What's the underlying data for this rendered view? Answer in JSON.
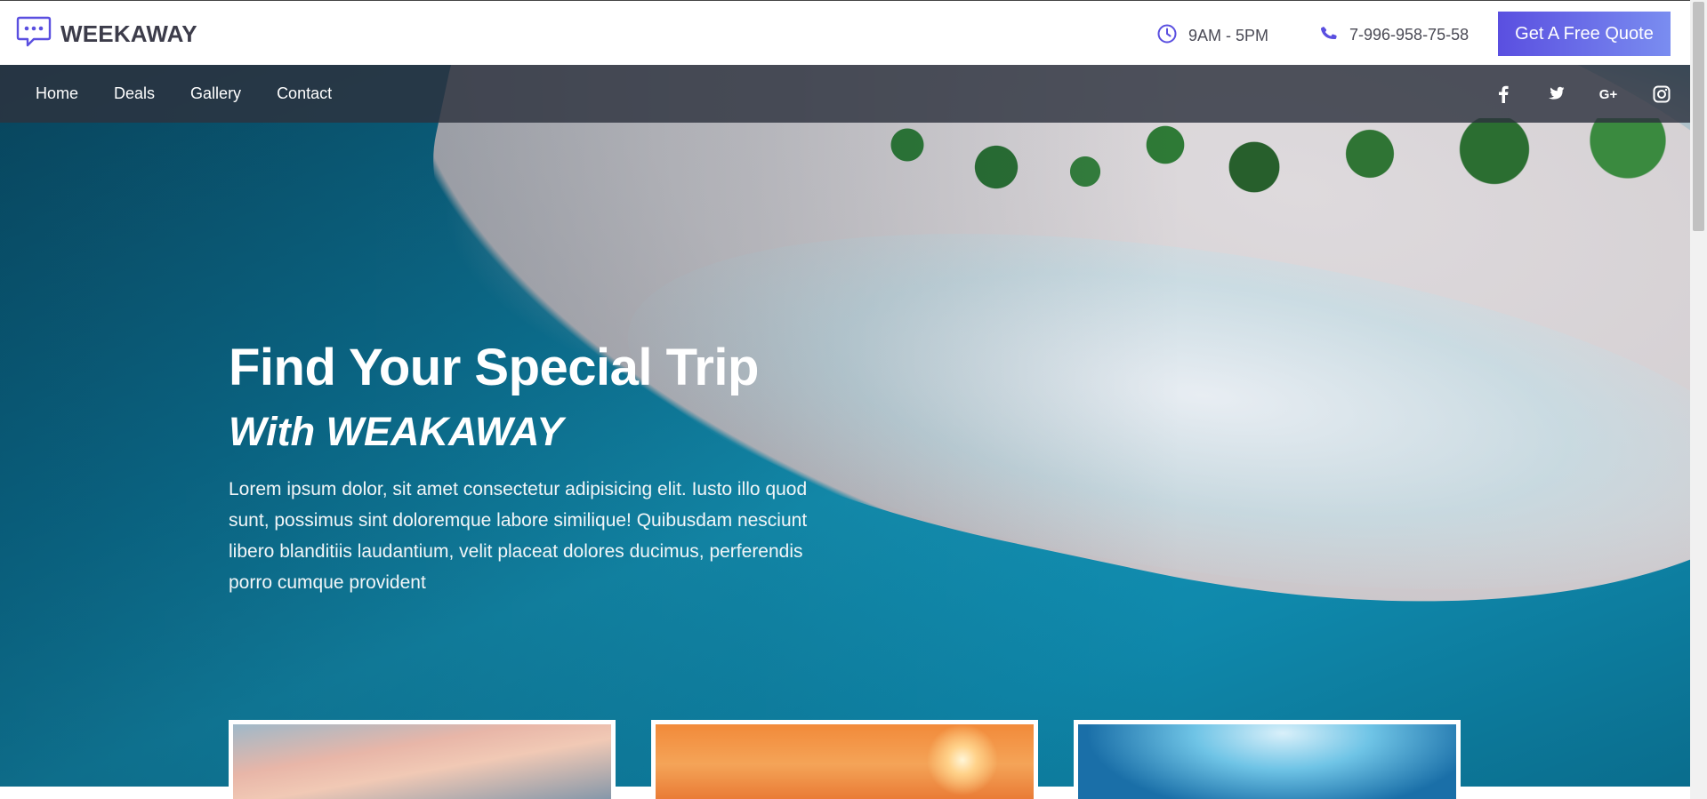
{
  "header": {
    "brand": "WEEKAWAY",
    "brand_icon": "chat-logo-icon",
    "hours": "9AM - 5PM",
    "phone": "7-996-958-75-58",
    "quote_button": "Get A Free Quote",
    "accent_color": "#5a4fe0"
  },
  "nav": {
    "links": [
      "Home",
      "Deals",
      "Gallery",
      "Contact"
    ],
    "social_icons": [
      "facebook-icon",
      "twitter-icon",
      "google-plus-icon",
      "instagram-icon"
    ],
    "google_plus_label": "G+"
  },
  "hero": {
    "title": "Find Your Special Trip",
    "subtitle": "With WEAKAWAY",
    "description": "Lorem ipsum dolor, sit amet consectetur adipisicing elit. Iusto illo quod sunt, possimus sint doloremque labore similique! Quibusdam nesciunt libero blanditiis laudantium, velit placeat dolores ducimus, perferendis porro cumque provident"
  },
  "cards": [
    {
      "name": "card-sunset-clouds"
    },
    {
      "name": "card-orange-sunset"
    },
    {
      "name": "card-underwater"
    }
  ]
}
